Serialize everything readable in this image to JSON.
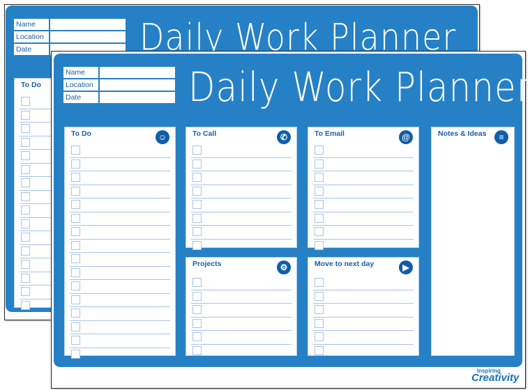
{
  "back_sheet": {
    "fields": [
      "Name",
      "Location",
      "Date"
    ],
    "title": "Daily Work Planner",
    "todo_title": "To Do"
  },
  "front_sheet": {
    "fields": [
      "Name",
      "Location",
      "Date"
    ],
    "title": "Daily Work Planner",
    "panels": {
      "todo": {
        "title": "To Do",
        "icon": "person-icon"
      },
      "call": {
        "title": "To Call",
        "icon": "phone-icon"
      },
      "email": {
        "title": "To Email",
        "icon": "at-sign-icon"
      },
      "notes": {
        "title": "Notes & Ideas",
        "icon": "notepad-icon"
      },
      "projects": {
        "title": "Projects",
        "icon": "gears-icon"
      },
      "move": {
        "title": "Move to next day",
        "icon": "play-arrow-icon"
      }
    }
  },
  "logo": {
    "line1": "Inspiring",
    "line2": "Creativity"
  },
  "colors": {
    "board": "#2680c5",
    "text": "#1b5fa6",
    "icon": "#0f5ea8",
    "lines": "#a9c4e6"
  }
}
